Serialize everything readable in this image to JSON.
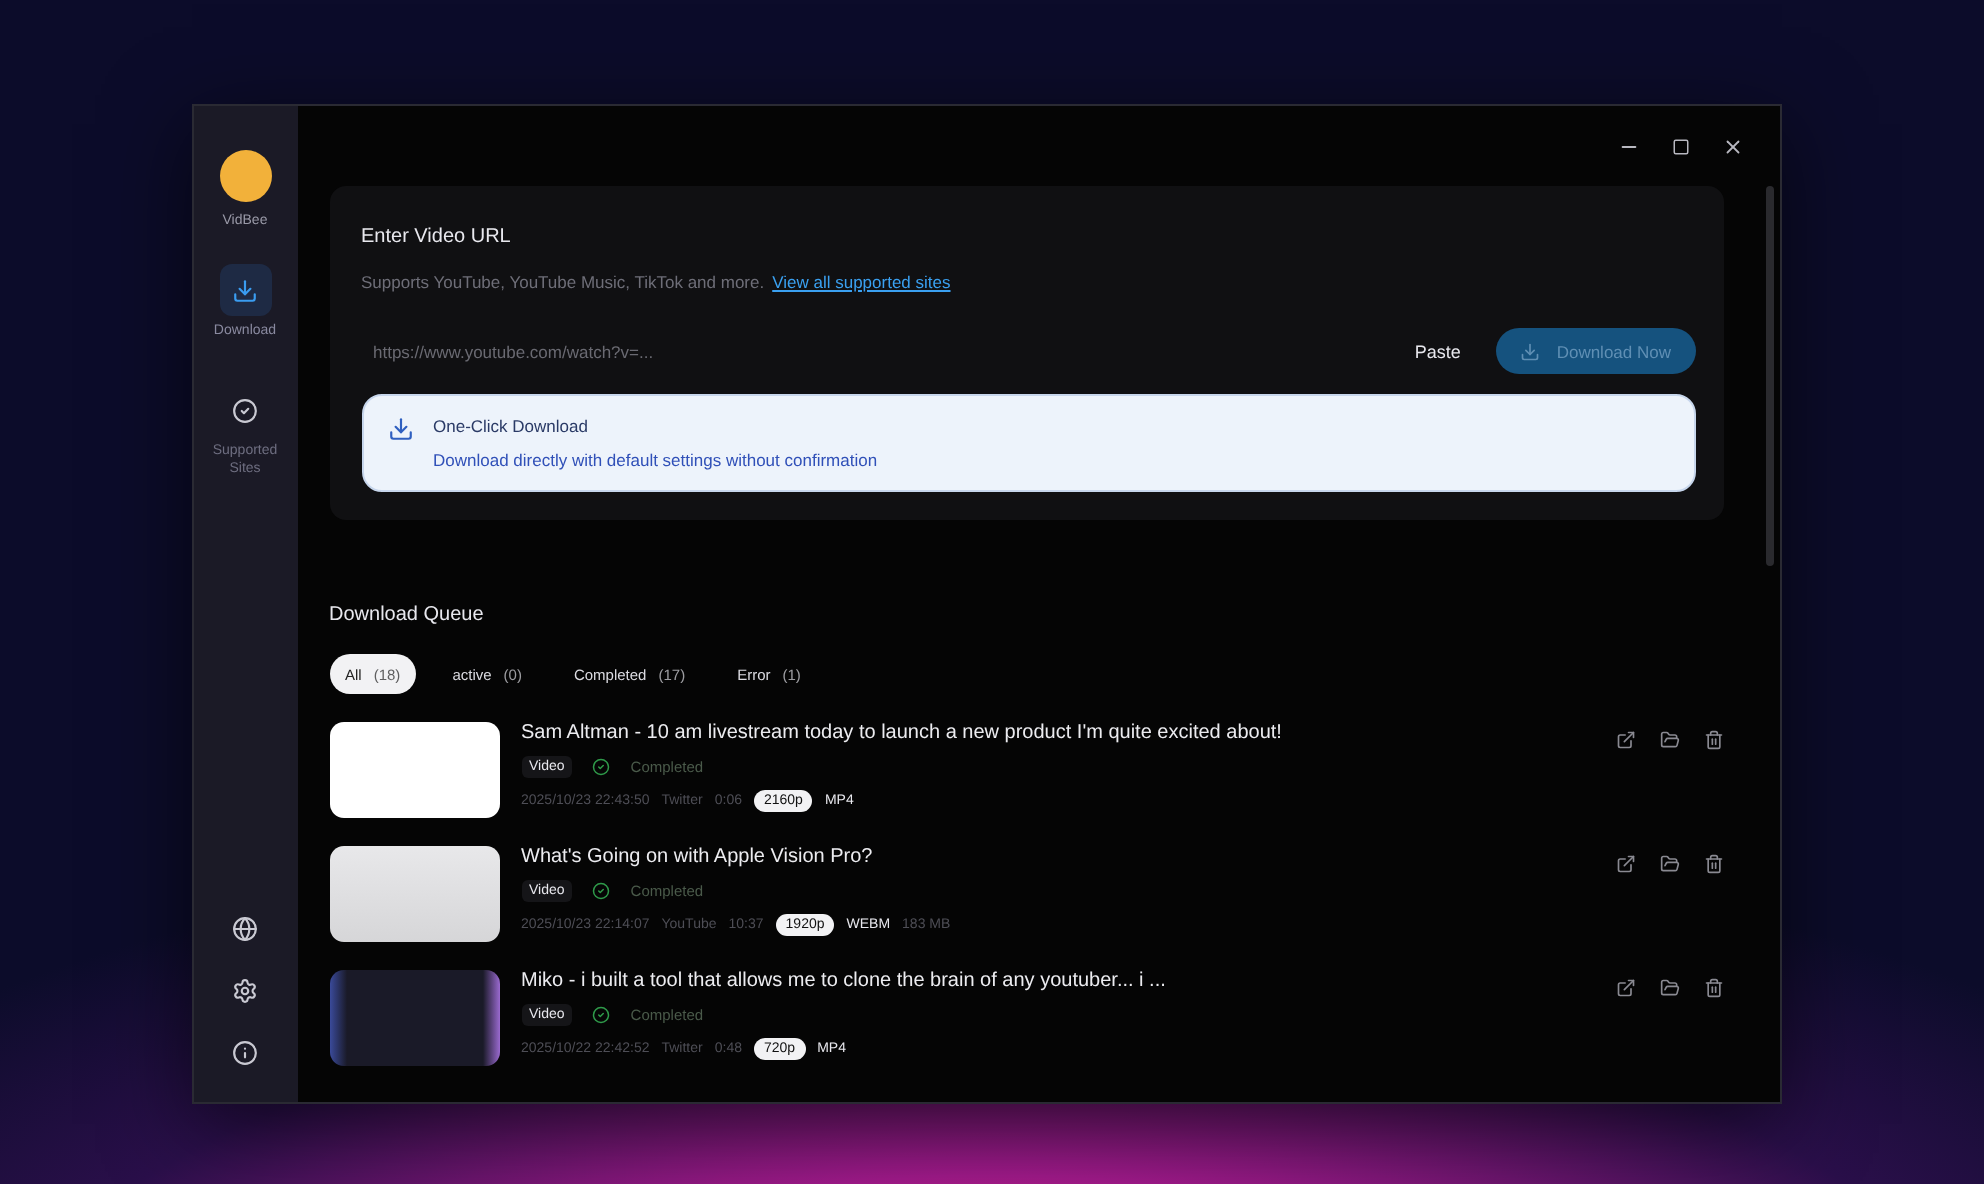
{
  "sidebar": {
    "app_name": "VidBee",
    "items": [
      {
        "label": "Download",
        "selected": true
      },
      {
        "label": "Supported Sites",
        "selected": false
      }
    ]
  },
  "url_section": {
    "title": "Enter Video URL",
    "subtitle": "Supports YouTube, YouTube Music, TikTok and more.",
    "link": "View all supported sites",
    "placeholder": "https://www.youtube.com/watch?v=...",
    "paste": "Paste",
    "download": {
      "label": "Download Now",
      "disabled": true
    },
    "one_click": {
      "title": "One-Click Download",
      "description": "Download directly with default settings without confirmation"
    }
  },
  "queue": {
    "title": "Download Queue",
    "filters": [
      {
        "label": "All",
        "count": "(18)",
        "selected": true
      },
      {
        "label": "active",
        "count": "(0)",
        "selected": false
      },
      {
        "label": "Completed",
        "count": "(17)",
        "selected": false
      },
      {
        "label": "Error",
        "count": "(1)",
        "selected": false
      }
    ],
    "items": [
      {
        "title": "Sam Altman - 10 am livestream today to launch a new product I'm quite excited about!",
        "type": "Video",
        "status": "Completed",
        "date": "2025/10/23 22:43:50",
        "site": "Twitter",
        "duration": "0:06",
        "resolution": "2160p",
        "format": "MP4"
      },
      {
        "title": "What's Going on with Apple Vision Pro?",
        "type": "Video",
        "status": "Completed",
        "date": "2025/10/23 22:14:07",
        "site": "YouTube",
        "duration": "10:37",
        "resolution": "1920p",
        "format": "WEBM",
        "size": "183 MB"
      },
      {
        "title": "Miko - i built a tool that allows me to clone the brain of any youtuber... i ...",
        "type": "Video",
        "status": "Completed",
        "date": "2025/10/22 22:42:52",
        "site": "Twitter",
        "duration": "0:48",
        "resolution": "720p",
        "format": "MP4"
      }
    ]
  }
}
